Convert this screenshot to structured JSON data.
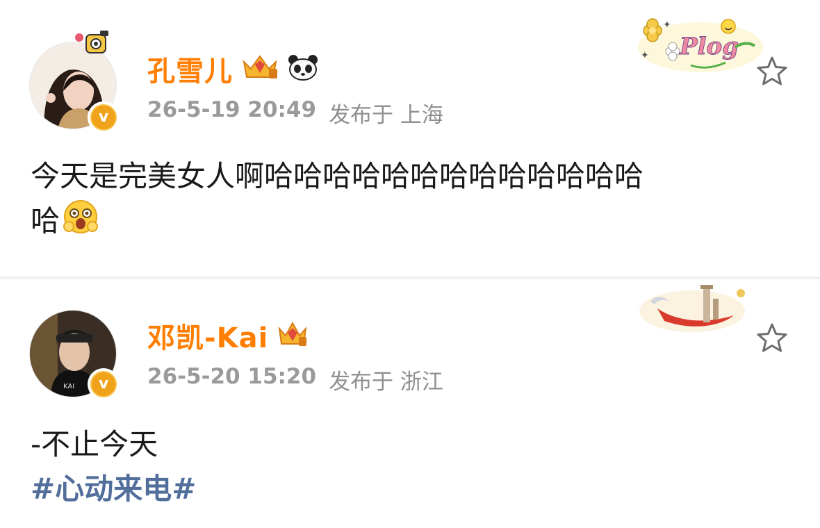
{
  "posts": [
    {
      "author": "孔雪儿",
      "time": "26-5-19 20:49",
      "location": "发布于 上海",
      "content_line1": "今天是完美女人啊哈哈哈哈哈哈哈哈哈哈哈哈哈",
      "content_line2": "哈",
      "card_decoration_text": "Plog"
    },
    {
      "author": "邓凯-Kai",
      "time": "26-5-20 15:20",
      "location": "发布于 浙江",
      "content_line1": "-不止今天",
      "hashtag": "#心动来电#"
    }
  ],
  "icons": {
    "verified": "verified-v-badge-icon",
    "crown": "crown-member-icon",
    "panda": "panda-emoji-icon",
    "star": "favorite-star-icon",
    "emoji": "surprised-face-emoji-icon"
  },
  "colors": {
    "name": "#ff7e00",
    "meta": "#8f8f8f",
    "hashtag": "#526e9b",
    "verified": "#f0a21a"
  },
  "verified_letter": "v"
}
